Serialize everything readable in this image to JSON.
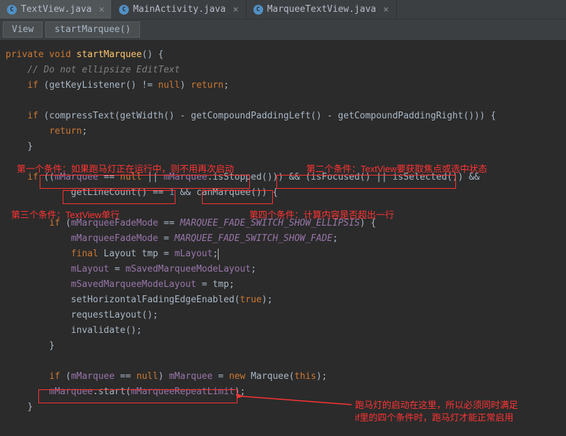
{
  "tabs": [
    {
      "label": "TextView.java",
      "active": true
    },
    {
      "label": "MainActivity.java",
      "active": false
    },
    {
      "label": "MarqueeTextView.java",
      "active": false
    }
  ],
  "breadcrumb": {
    "class": "View",
    "method": "startMarquee()"
  },
  "code": {
    "l1_kw1": "private",
    "l1_kw2": "void",
    "l1_method": "startMarquee",
    "l1_rest": "() {",
    "l2_comment": "// Do not ellipsize EditText",
    "l3_kw": "if",
    "l3_a": " (getKeyListener() != ",
    "l3_null": "null",
    "l3_b": ") ",
    "l3_ret": "return",
    "l3_c": ";",
    "l4_kw": "if",
    "l4_a": " (compressText(getWidth() - getCompoundPaddingLeft() - getCompoundPaddingRight())) {",
    "l5_ret": "return",
    "l5_a": ";",
    "l6": "}",
    "l7_kw": "if",
    "l7_a": " ((",
    "l7_f1": "mMarquee",
    "l7_b": " == ",
    "l7_null": "null",
    "l7_c": " || ",
    "l7_f2": "mMarquee",
    "l7_d": ".isStopped()))",
    "l7_e": " && ",
    "l7_f": "(isFocused() || isSelected())",
    "l7_g": " &&",
    "l8_a": "getLineCount() == ",
    "l8_num": "1",
    "l8_b": " && ",
    "l8_c": "canMarquee()",
    "l8_d": ") {",
    "l9_kw": "if",
    "l9_a": " (",
    "l9_f": "mMarqueeFadeMode",
    "l9_b": " == ",
    "l9_c1": "MARQUEE_FADE_SWITCH_SHOW_ELLIPSIS",
    "l9_c": ") {",
    "l10_f": "mMarqueeFadeMode",
    "l10_a": " = ",
    "l10_c1": "MARQUEE_FADE_SWITCH_SHOW_FADE",
    "l10_b": ";",
    "l11_kw": "final",
    "l11_a": " Layout tmp = ",
    "l11_f": "mLayout",
    "l11_b": ";",
    "l12_f": "mLayout",
    "l12_a": " = ",
    "l12_f2": "mSavedMarqueeModeLayout",
    "l12_b": ";",
    "l13_f": "mSavedMarqueeModeLayout",
    "l13_a": " = tmp;",
    "l14_a": "setHorizontalFadingEdgeEnabled(",
    "l14_kw": "true",
    "l14_b": ");",
    "l15": "requestLayout();",
    "l16": "invalidate();",
    "l17": "}",
    "l18_kw": "if",
    "l18_a": " (",
    "l18_f": "mMarquee",
    "l18_b": " == ",
    "l18_null": "null",
    "l18_c": ") ",
    "l18_f2": "mMarquee",
    "l18_d": " = ",
    "l18_new": "new",
    "l18_e": " Marquee(",
    "l18_this": "this",
    "l18_g": ");",
    "l19_f": "mMarquee",
    "l19_a": ".start(",
    "l19_f2": "mMarqueeRepeatLimit",
    "l19_b": ");",
    "l20": "}"
  },
  "annotations": {
    "a1": "第一个条件：如果跑马灯正在运行中，则不用再次启动",
    "a2": "第二个条件：TextView要获取焦点或选中状态",
    "a3": "第三个条件：TextView单行",
    "a4": "第四个条件：计算内容是否超出一行",
    "a5": "跑马灯的启动在这里，所以必须同时满足",
    "a6": "if里的四个条件时，跑马灯才能正常启用"
  }
}
